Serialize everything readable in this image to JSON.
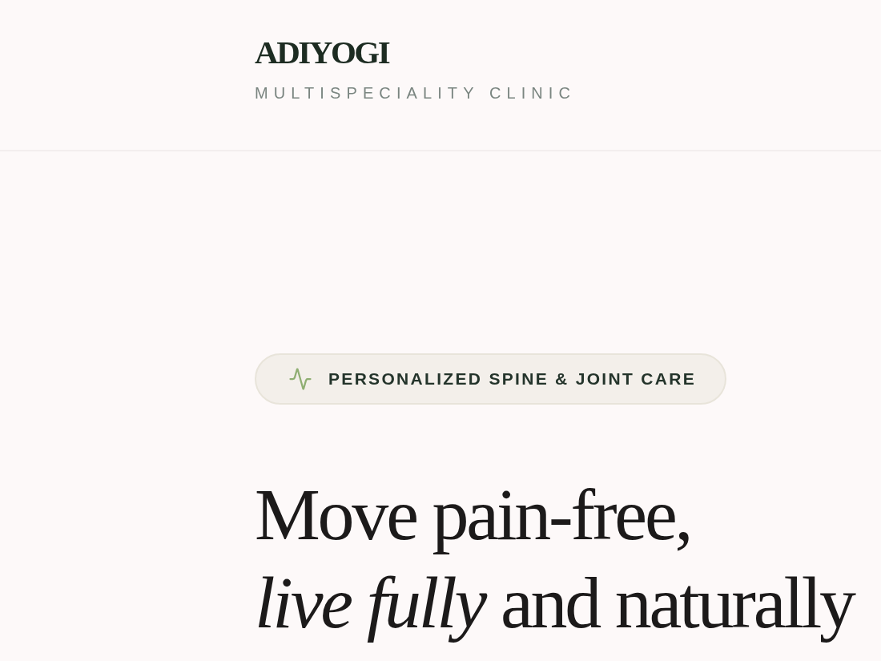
{
  "header": {
    "logo": {
      "name": "ADIYOGI",
      "tagline": "MULTISPECIALITY CLINIC"
    }
  },
  "hero": {
    "badge": {
      "label": "PERSONALIZED SPINE & JOINT CARE"
    },
    "headline": {
      "lines": [
        "Move pain-free,",
        "*live fully* and naturally"
      ]
    }
  }
}
